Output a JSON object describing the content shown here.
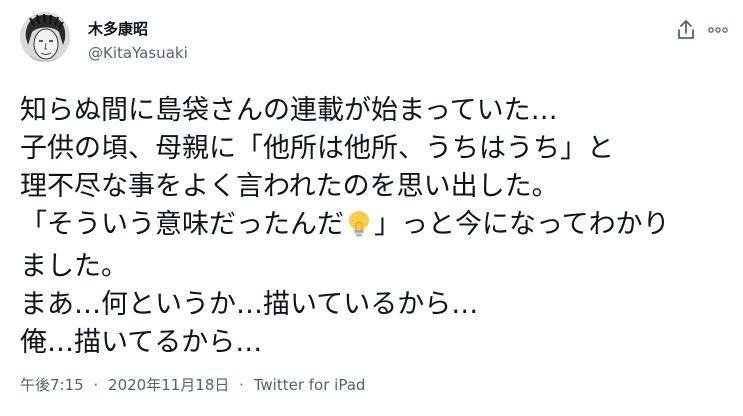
{
  "author": {
    "display_name": "木多康昭",
    "handle": "@KitaYasuaki"
  },
  "tweet": {
    "lines": [
      "知らぬ間に島袋さんの連載が始まっていた…",
      "子供の頃、母親に「他所は他所、うちはうち」と",
      "理不尽な事をよく言われたのを思い出した。",
      "「そういう意味だったんだ",
      "」っと今になってわかり",
      "ました。",
      "まあ…何というか…描いているから…",
      "俺…描いてるから…"
    ],
    "emoji": "light-bulb"
  },
  "meta": {
    "time": "午後7:15",
    "separator": "·",
    "date": "2020年11月18日",
    "source": "Twitter for iPad"
  },
  "icons": {
    "share": "share-icon",
    "more": "more-options-icon"
  },
  "colors": {
    "text": "#0f1419",
    "secondary": "#536471",
    "background": "#ffffff"
  }
}
